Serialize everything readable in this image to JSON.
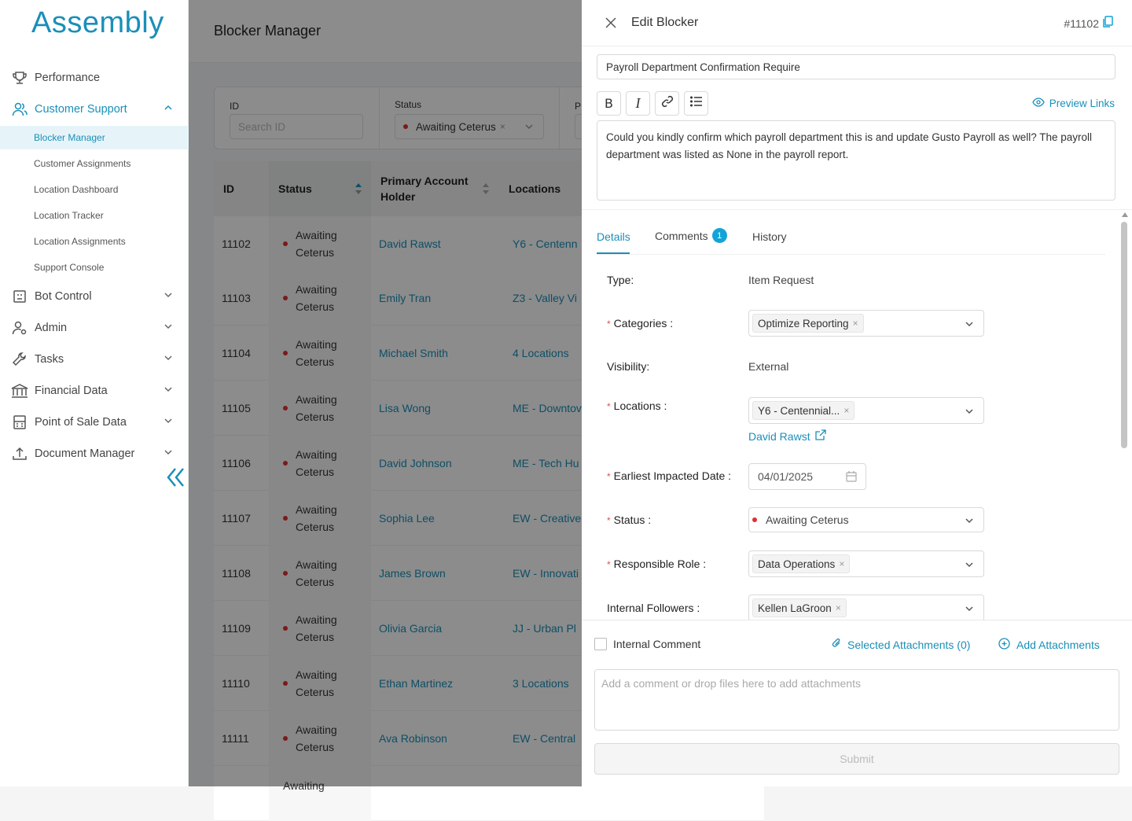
{
  "app": {
    "logo": "Assembly"
  },
  "sidebar": {
    "items": [
      {
        "label": "Performance"
      },
      {
        "label": "Customer Support"
      },
      {
        "label": "Bot Control"
      },
      {
        "label": "Admin"
      },
      {
        "label": "Tasks"
      },
      {
        "label": "Financial Data"
      },
      {
        "label": "Point of Sale Data"
      },
      {
        "label": "Document Manager"
      }
    ],
    "subitems": [
      {
        "label": "Blocker Manager"
      },
      {
        "label": "Customer Assignments"
      },
      {
        "label": "Location Dashboard"
      },
      {
        "label": "Location Tracker"
      },
      {
        "label": "Location Assignments"
      },
      {
        "label": "Support Console"
      }
    ]
  },
  "page": {
    "title": "Blocker Manager"
  },
  "filters": {
    "id_label": "ID",
    "id_placeholder": "Search ID",
    "status_label": "Status",
    "status_value": "Awaiting Ceterus",
    "third_label": "P"
  },
  "table": {
    "headers": {
      "id": "ID",
      "status": "Status",
      "holder": "Primary Account Holder",
      "locations": "Locations"
    },
    "rows": [
      {
        "id": "11102",
        "status": "Awaiting Ceterus",
        "holder": "David Rawst",
        "location": "Y6 - Centenn"
      },
      {
        "id": "11103",
        "status": "Awaiting Ceterus",
        "holder": "Emily Tran",
        "location": "Z3 - Valley Vi"
      },
      {
        "id": "11104",
        "status": "Awaiting Ceterus",
        "holder": "Michael Smith",
        "location": "4 Locations"
      },
      {
        "id": "11105",
        "status": "Awaiting Ceterus",
        "holder": "Lisa Wong",
        "location": "ME - Downtov"
      },
      {
        "id": "11106",
        "status": "Awaiting Ceterus",
        "holder": "David Johnson",
        "location": "ME - Tech Hu"
      },
      {
        "id": "11107",
        "status": "Awaiting Ceterus",
        "holder": "Sophia Lee",
        "location": "EW - Creative"
      },
      {
        "id": "11108",
        "status": "Awaiting Ceterus",
        "holder": "James Brown",
        "location": "EW - Innovati"
      },
      {
        "id": "11109",
        "status": "Awaiting Ceterus",
        "holder": "Olivia Garcia",
        "location": "JJ - Urban Pl"
      },
      {
        "id": "11110",
        "status": "Awaiting Ceterus",
        "holder": "Ethan Martinez",
        "location": "3 Locations"
      },
      {
        "id": "11111",
        "status": "Awaiting Ceterus",
        "holder": "Ava Robinson",
        "location": "EW - Central"
      },
      {
        "id": "",
        "status": "Awaiting",
        "holder": "",
        "location": ""
      }
    ]
  },
  "drawer": {
    "title": "Edit Blocker",
    "ticket_id": "#11102",
    "blocker_title": "Payroll Department Confirmation Require",
    "preview_links": "Preview Links",
    "body": "Could you kindly confirm which payroll department this is and update Gusto Payroll as well? The payroll department was listed as None in the payroll report.",
    "tabs": {
      "details": "Details",
      "comments": "Comments",
      "comments_count": "1",
      "history": "History"
    },
    "fields": {
      "type_label": "Type:",
      "type_value": "Item Request",
      "categories_label": "Categories :",
      "categories_value": "Optimize Reporting",
      "visibility_label": "Visibility:",
      "visibility_value": "External",
      "locations_label": "Locations :",
      "locations_value": "Y6 - Centennial...",
      "locations_link": "David Rawst",
      "date_label": "Earliest Impacted Date :",
      "date_value": "04/01/2025",
      "status_label": "Status :",
      "status_value": "Awaiting Ceterus",
      "role_label": "Responsible Role :",
      "role_value": "Data Operations",
      "followers_label": "Internal Followers :",
      "followers_value": "Kellen LaGroon"
    },
    "footer": {
      "internal_comment": "Internal Comment",
      "selected_attachments": "Selected Attachments (0)",
      "add_attachments": "Add Attachments",
      "comment_placeholder": "Add a comment or drop files here to add attachments",
      "submit": "Submit"
    }
  },
  "colors": {
    "accent": "#1a8fb8",
    "status_dot": "#e03030",
    "badge": "#14a3d9"
  }
}
